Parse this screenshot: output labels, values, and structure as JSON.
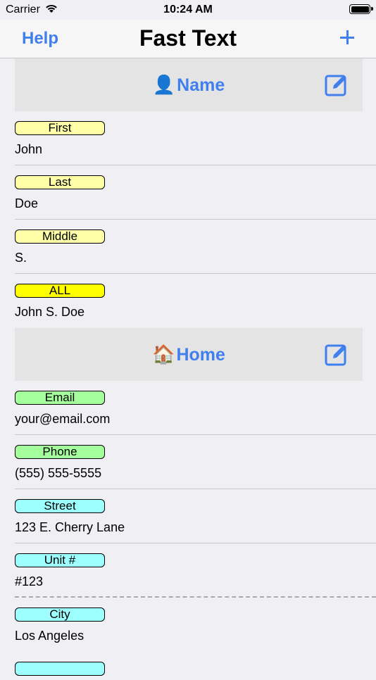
{
  "status": {
    "carrier": "Carrier",
    "time": "10:24 AM"
  },
  "nav": {
    "help": "Help",
    "title": "Fast Text"
  },
  "sections": [
    {
      "emoji": "👤",
      "title": "Name",
      "items": [
        {
          "label": "First",
          "value": "John"
        },
        {
          "label": "Last",
          "value": "Doe"
        },
        {
          "label": "Middle",
          "value": "S."
        },
        {
          "label": "ALL",
          "value": "John S. Doe"
        }
      ]
    },
    {
      "emoji": "🏠",
      "title": "Home",
      "items": [
        {
          "label": "Email",
          "value": "your@email.com"
        },
        {
          "label": "Phone",
          "value": "(555) 555-5555"
        },
        {
          "label": "Street",
          "value": "123 E. Cherry Lane"
        },
        {
          "label": "Unit #",
          "value": "#123"
        },
        {
          "label": "City",
          "value": "Los Angeles"
        }
      ]
    }
  ],
  "colors": {
    "accent": "#3f7fee",
    "tag_yellow": "#ffffa8",
    "tag_yellow_strong": "#ffff00",
    "tag_green": "#a4ff9c",
    "tag_cyan": "#9effff"
  }
}
